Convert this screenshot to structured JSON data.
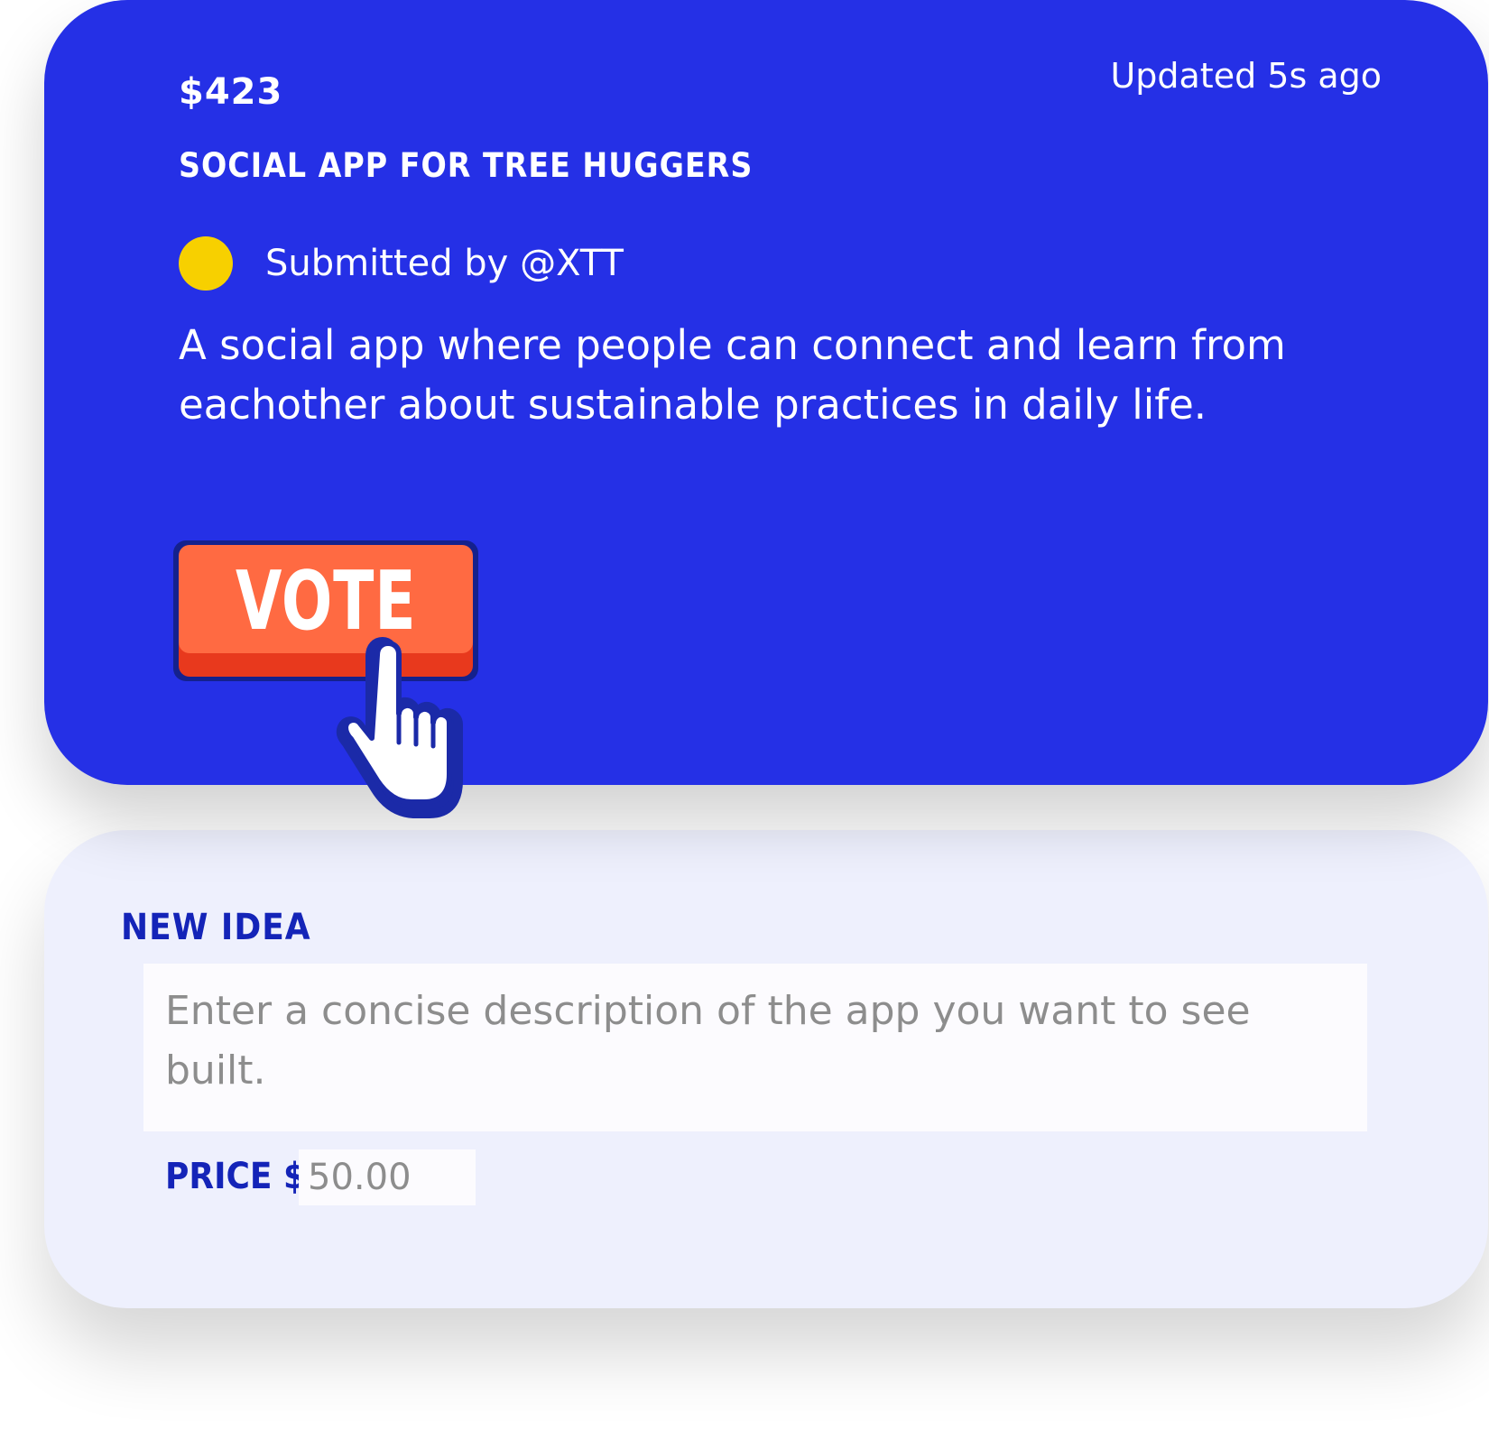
{
  "idea": {
    "price": "$423",
    "updated": "Updated 5s ago",
    "title": "SOCIAL APP FOR TREE HUGGERS",
    "submitted_by": "Submitted by @XTT",
    "description": "A social app where people can connect and learn from eachother about sustainable practices in daily life.",
    "vote_label": "VOTE",
    "avatar_color": "#f7d000",
    "card_color": "#2530e6",
    "vote_color": "#ff6a42",
    "icons": [
      "pointing-hand-icon"
    ]
  },
  "new_idea_form": {
    "heading": "NEW IDEA",
    "description_placeholder": "Enter a concise description of the app you want to see built.",
    "price_label": "PRICE $",
    "price_placeholder": "50.00",
    "card_color": "#eef0fd",
    "accent_color": "#1424b8"
  }
}
